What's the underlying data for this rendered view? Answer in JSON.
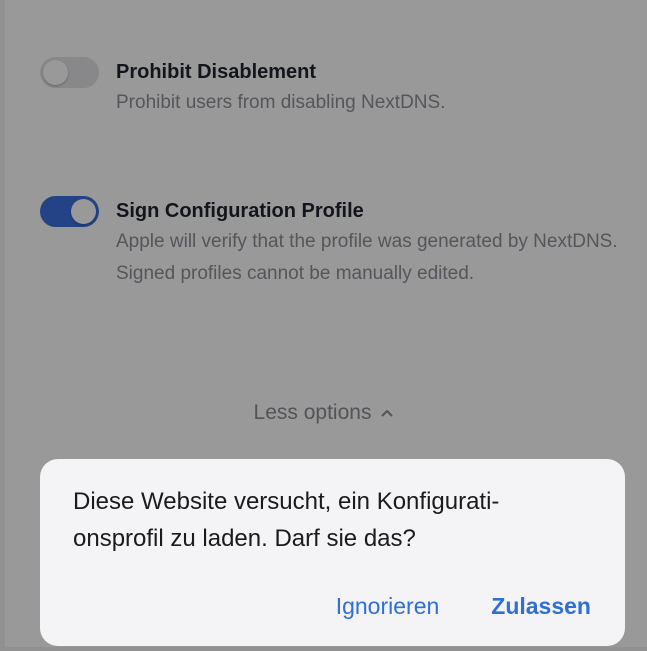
{
  "settings": [
    {
      "title": "Prohibit Disablement",
      "description": "Prohibit users from disabling NextDNS.",
      "enabled": false
    },
    {
      "title": "Sign Configuration Profile",
      "description": "Apple will verify that the profile was generated by NextDNS. Signed profiles cannot be manually edited.",
      "enabled": true
    }
  ],
  "less_options": {
    "label": "Less options",
    "icon": "chevron-up-icon"
  },
  "dialog": {
    "message_line1": "Diese Website versucht, ein Konfigurati-",
    "message_line2": "onsprofil zu laden. Darf sie das?",
    "ignore_label": "Ignorieren",
    "allow_label": "Zulassen"
  },
  "colors": {
    "toggle_on": "#3d6fe0",
    "toggle_off": "#e3e3e6",
    "accent": "#2f6fd6",
    "dialog_background": "#f4f4f7"
  }
}
